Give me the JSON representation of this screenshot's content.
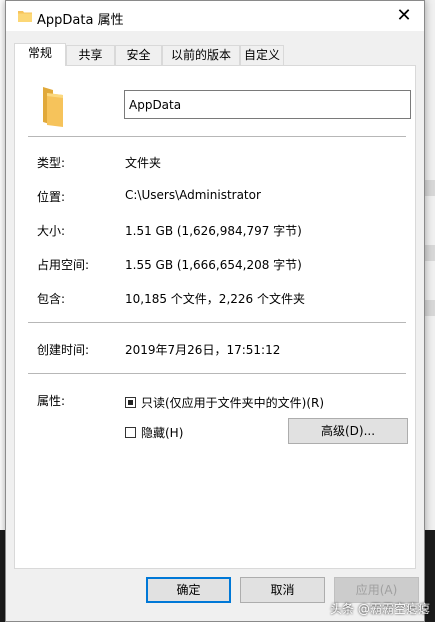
{
  "window": {
    "title": "AppData 属性",
    "close_glyph": "✕"
  },
  "tabs": [
    {
      "label": "常规"
    },
    {
      "label": "共享"
    },
    {
      "label": "安全"
    },
    {
      "label": "以前的版本"
    },
    {
      "label": "自定义"
    }
  ],
  "general": {
    "folder_name": "AppData",
    "rows": [
      {
        "label": "类型:",
        "value": "文件夹"
      },
      {
        "label": "位置:",
        "value": "C:\\Users\\Administrator"
      },
      {
        "label": "大小:",
        "value": "1.51 GB (1,626,984,797 字节)"
      },
      {
        "label": "占用空间:",
        "value": "1.55 GB (1,666,654,208 字节)"
      },
      {
        "label": "包含:",
        "value": "10,185 个文件，2,226 个文件夹"
      }
    ],
    "created_label": "创建时间:",
    "created_value": "2019年7月26日，17:51:12",
    "attributes_label": "属性:",
    "readonly_label": "只读(仅应用于文件夹中的文件)(R)",
    "hidden_label": "隐藏(H)",
    "advanced_label": "高级(D)..."
  },
  "footer": {
    "ok": "确定",
    "cancel": "取消",
    "apply": "应用(A)"
  },
  "watermark": "头条 @霸霸空瘪瘪",
  "colors": {
    "folder": "#f6c35b",
    "folder_dark": "#e1a93a",
    "accent": "#0078d7"
  },
  "icons": {
    "title": "folder-icon",
    "large": "folder-icon"
  }
}
